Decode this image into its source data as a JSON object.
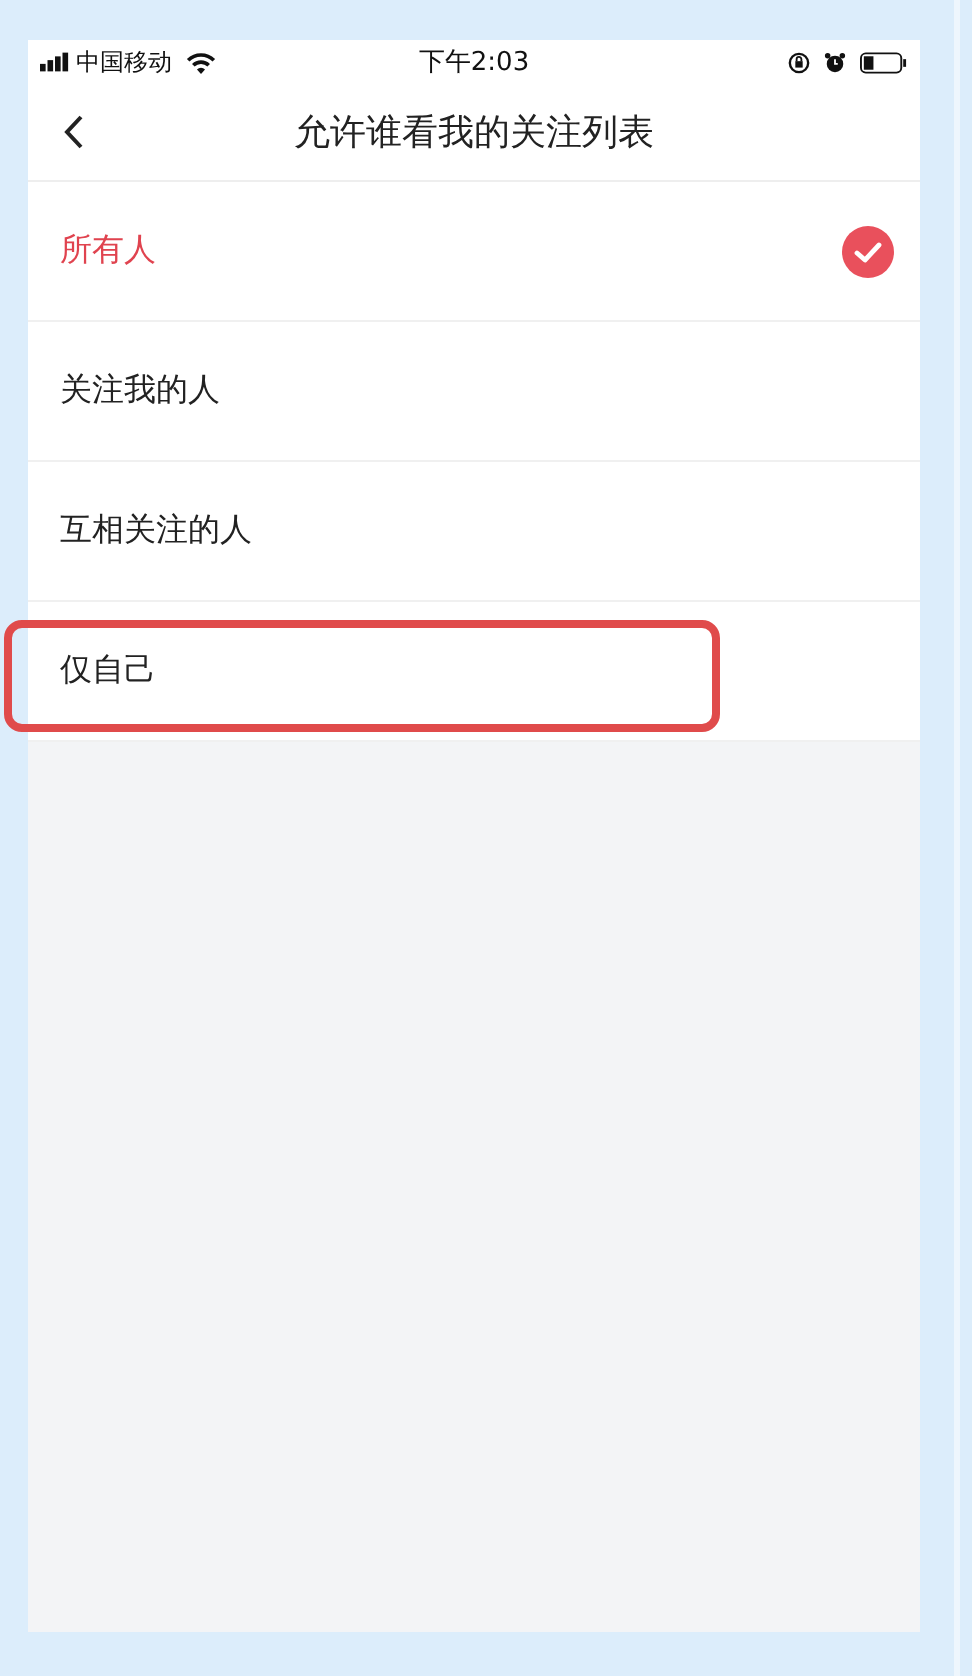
{
  "status_bar": {
    "carrier": "中国移动",
    "time": "下午2:03"
  },
  "nav": {
    "title": "允许谁看我的关注列表"
  },
  "options": [
    {
      "label": "所有人",
      "selected": true,
      "annotated": false
    },
    {
      "label": "关注我的人",
      "selected": false,
      "annotated": false
    },
    {
      "label": "互相关注的人",
      "selected": false,
      "annotated": false
    },
    {
      "label": "仅自己",
      "selected": false,
      "annotated": true
    }
  ]
}
